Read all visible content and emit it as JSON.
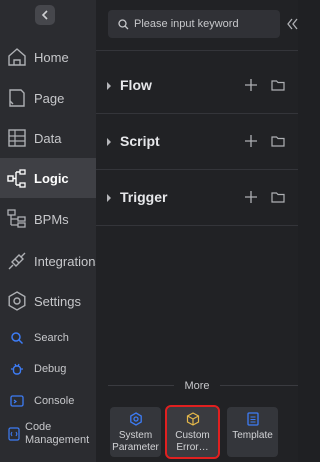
{
  "sidebar": {
    "items": [
      {
        "label": "Home"
      },
      {
        "label": "Page"
      },
      {
        "label": "Data"
      },
      {
        "label": "Logic"
      },
      {
        "label": "BPMs"
      },
      {
        "label": "Integrations"
      },
      {
        "label": "Settings"
      },
      {
        "label": "Search"
      },
      {
        "label": "Debug"
      },
      {
        "label": "Console"
      },
      {
        "label": "Code Management"
      }
    ],
    "active_item": "Logic"
  },
  "panel": {
    "search": {
      "placeholder": "Please input keyword"
    },
    "sections": [
      {
        "title": "Flow"
      },
      {
        "title": "Script"
      },
      {
        "title": "Trigger"
      }
    ],
    "more": {
      "label": "More",
      "tools": [
        {
          "label": "System\nParameter"
        },
        {
          "label": "Custom\nError…"
        },
        {
          "label": "Template"
        }
      ]
    }
  },
  "colors": {
    "accent_blue": "#3d7cf5",
    "accent_yellow": "#e5b84a",
    "selection_red": "#e02020"
  }
}
